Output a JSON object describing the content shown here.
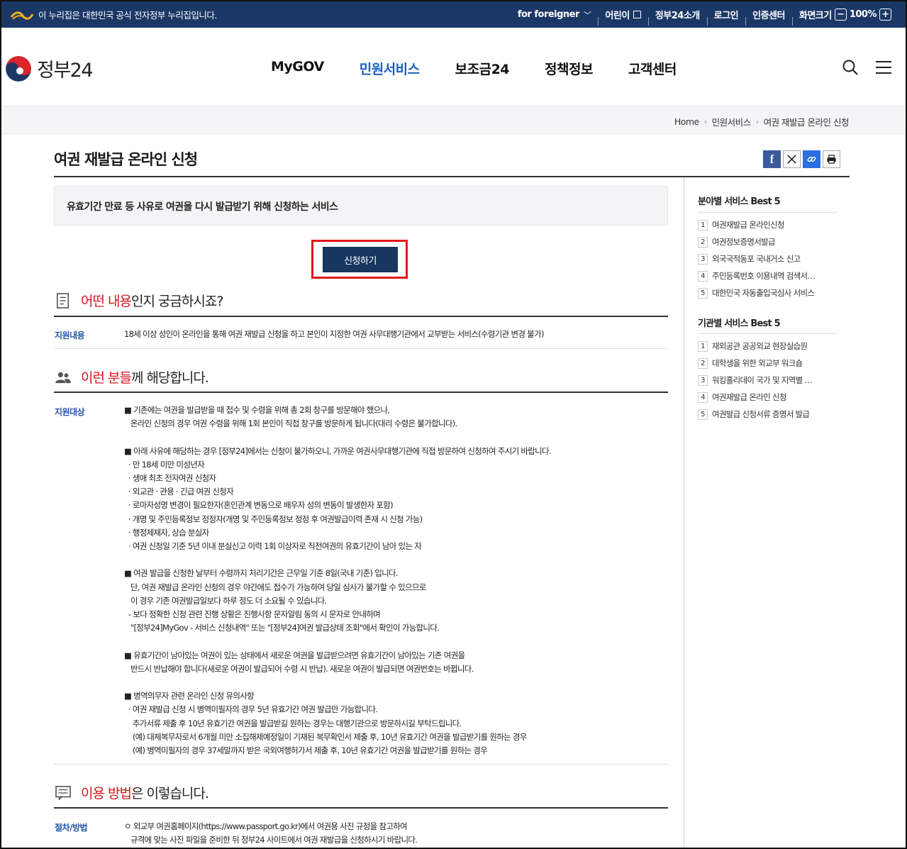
{
  "gov_bar": {
    "notice": "이 누리집은 대한민국 공식 전자정부 누리집입니다.",
    "links": [
      "for foreigner",
      "어린이",
      "정부24소개",
      "로그인",
      "인증센터",
      "화면크기"
    ],
    "zoom": "100%"
  },
  "header": {
    "brand": "정부24",
    "nav": [
      "MyGOV",
      "민원서비스",
      "보조금24",
      "정책정보",
      "고객센터"
    ],
    "active_nav": "민원서비스"
  },
  "breadcrumb": [
    "Home",
    "민원서비스",
    "여권 재발급 온라인 신청"
  ],
  "page": {
    "title": "여권 재발급 온라인 신청",
    "summary": "유효기간 만료 등 사유로 여권을 다시 발급받기 위해 신청하는 서비스",
    "apply_button": "신청하기"
  },
  "sections": {
    "content": {
      "title_hl": "어떤 내용",
      "title_rest": "인지 궁금하시죠?",
      "label": "지원내용",
      "text": "18세 이상 성인이 온라인을 통해 여권 재발급 신청을 하고 본인이 지정한 여권 사무대행기관에서 교부받는 서비스(수령기관 변경 불가)"
    },
    "target": {
      "title_hl": "이런 분들",
      "title_rest": "께 해당합니다.",
      "label": "지원대상",
      "lines": [
        "■ 기존에는 여권을 발급받을 때 접수 및 수령을 위해 총 2회 창구를 방문해야 했으나,",
        "   온라인 신청의 경우 여권 수령을 위해 1회 본인이 직접 창구를 방문하게 됩니다(대리 수령은 불가합니다).",
        "",
        "■ 아래 사유에 해당하는 경우 [정부24]에서는 신청이 불가하오니, 가까운 여권사무대행기관에 직접 방문하여 신청하여 주시기 바랍니다.",
        "  · 만 18세 미만 미성년자",
        "  · 생애 최초 전자여권 신청자",
        "  · 외교관 · 관용 · 긴급 여권 신청자",
        "  · 로마자성명 변경이 필요한자(혼인관계 변동으로 배우자 성의 변동이 발생한자 포함)",
        "  · 개명 및 주민등록정보 정정자(개명 및 주민등록정보 정정 후 여권발급이력 존재 시 신청 가능)",
        "  · 행정제재자, 상습 분실자",
        "  · 여권 신청일 기준 5년 이내 분실신고 이력 1회 이상자로 직전여권의 유효기간이 남아 있는 자",
        "",
        "■ 여권 발급을 신청한 날부터 수령까지 처리기간은 근무일 기준 8일(국내 기준) 입니다.",
        "   단, 여권 재발급 온라인 신청의 경우 야간에도 접수가 가능하여 당일 심사가 불가할 수 있으므로",
        "   이 경우 기존 여권발급일보다 하루 정도 더 소요될 수 있습니다.",
        "  - 보다 정확한 신청 관련 진행 상황은 진행사항 문자알림 동의 시 문자로 안내하며",
        "   \"[정부24]MyGov - 서비스 신청내역\" 또는 \"[정부24]여권 발급상태 조회\"에서 확인이 가능합니다.",
        "",
        "■ 유효기간이 남아있는 여권이 있는 상태에서 새로운 여권을 발급받으려면 유효기간이 남아있는 기존 여권을",
        "   반드시 반납해야 합니다(새로운 여권이 발급되어 수령 시 반납). 새로운 여권이 발급되면 여권번호는 바뀝니다.",
        "",
        "■ 병역의무자 관련 온라인 신청 유의사항",
        "  · 여권 재발급 신청 시 병역미필자의 경우 5년 유효기간 여권 발급만 가능합니다.",
        "    추가서류 제출 후 10년 유효기간 여권을 발급받길 원하는 경우는 대행기관으로 방문하시길 부탁드립니다.",
        "    (예) 대체복무자로서 6개월 미만 소집해제예정일이 기재된 복무확인서 제출 후, 10년 유효기간 여권을 발급받기를 원하는 경우",
        "    (예) 병역미필자의 경우 37세말까지 받은 국외여행허가서 제출 후, 10년 유효기간 여권을 발급받기를 원하는 경우"
      ]
    },
    "method": {
      "title_hl": "이용 방법",
      "title_rest": "은 이렇습니다.",
      "label": "절차/방법",
      "lines": [
        "ㅇ 외교부 여권홈페이지(https://www.passport.go.kr)에서 여권용 사진 규정을 참고하여",
        "   규격에 맞는 사진 파일을 준비한 뒤 정부24 사이트에서 여권 재발급을 신청하시기 바랍니다."
      ]
    }
  },
  "sidebar": {
    "field_title": "분야별 서비스 Best 5",
    "field_items": [
      "여권재발급 온라인신청",
      "여권정보증명서발급",
      "외국국적동포 국내거소 신고",
      "주민등록번호 이용내역 검색서…",
      "대한민국 자동출입국심사 서비스"
    ],
    "org_title": "기관별 서비스 Best 5",
    "org_items": [
      "재외공관 공공외교 현장실습원",
      "대학생을 위한 외교부 워크숍",
      "워킹홀리데이 국가 및 지역별 …",
      "여권재발급 온라인 신청",
      "여권발급 신청서류 증명서 발급"
    ]
  },
  "colors": {
    "gov_bar": "#1b3766",
    "active_nav": "#1d5fbf",
    "highlight": "#d4161c",
    "apply_btn": "#173660",
    "label": "#2453a6"
  }
}
